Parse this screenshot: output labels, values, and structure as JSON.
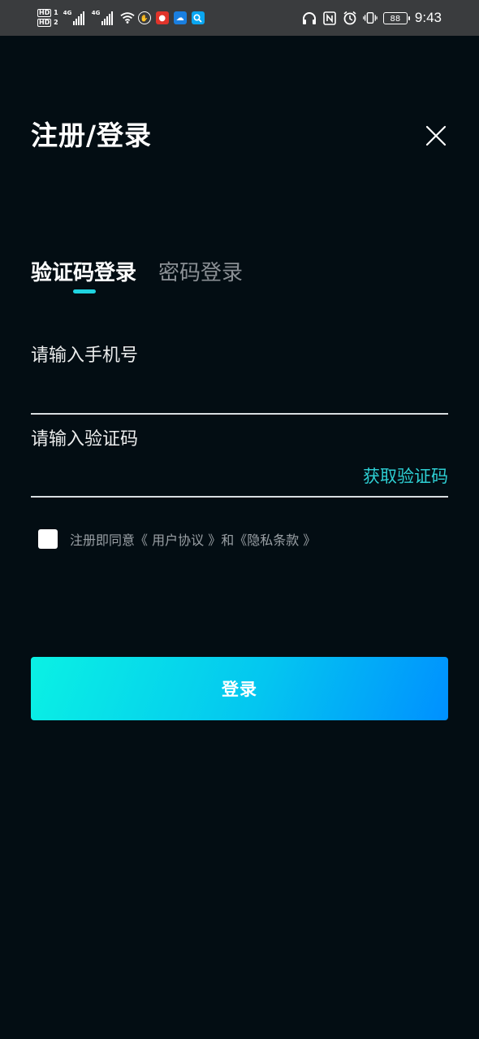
{
  "status_bar": {
    "sim1_label": "HD",
    "sim1_num": "1",
    "sim2_label": "HD",
    "sim2_num": "2",
    "network1": "4G",
    "network2": "4G",
    "battery": "88",
    "time": "9:43"
  },
  "header": {
    "title": "注册/登录"
  },
  "tabs": {
    "code_login": "验证码登录",
    "password_login": "密码登录",
    "active_tab": "code_login"
  },
  "form": {
    "phone_placeholder": "请输入手机号",
    "phone_value": "",
    "code_placeholder": "请输入验证码",
    "code_value": "",
    "get_code_label": "获取验证码"
  },
  "agreement": {
    "checked": false,
    "prefix": "注册即同意",
    "user_agreement": "《 用户协议 》",
    "conjunction": "和",
    "privacy_policy": "《隐私条款 》"
  },
  "login_button": {
    "label": "登录"
  },
  "colors": {
    "background": "#030d13",
    "accent": "#1fd3e0",
    "link": "#2ecfd3",
    "button_gradient_start": "#0af1e4",
    "button_gradient_end": "#0090ff"
  },
  "icons": {
    "close": "close-icon",
    "wifi": "wifi-icon",
    "headphones": "headphones-icon",
    "nfc": "nfc-icon",
    "alarm": "alarm-icon",
    "vibrate": "vibrate-icon"
  }
}
